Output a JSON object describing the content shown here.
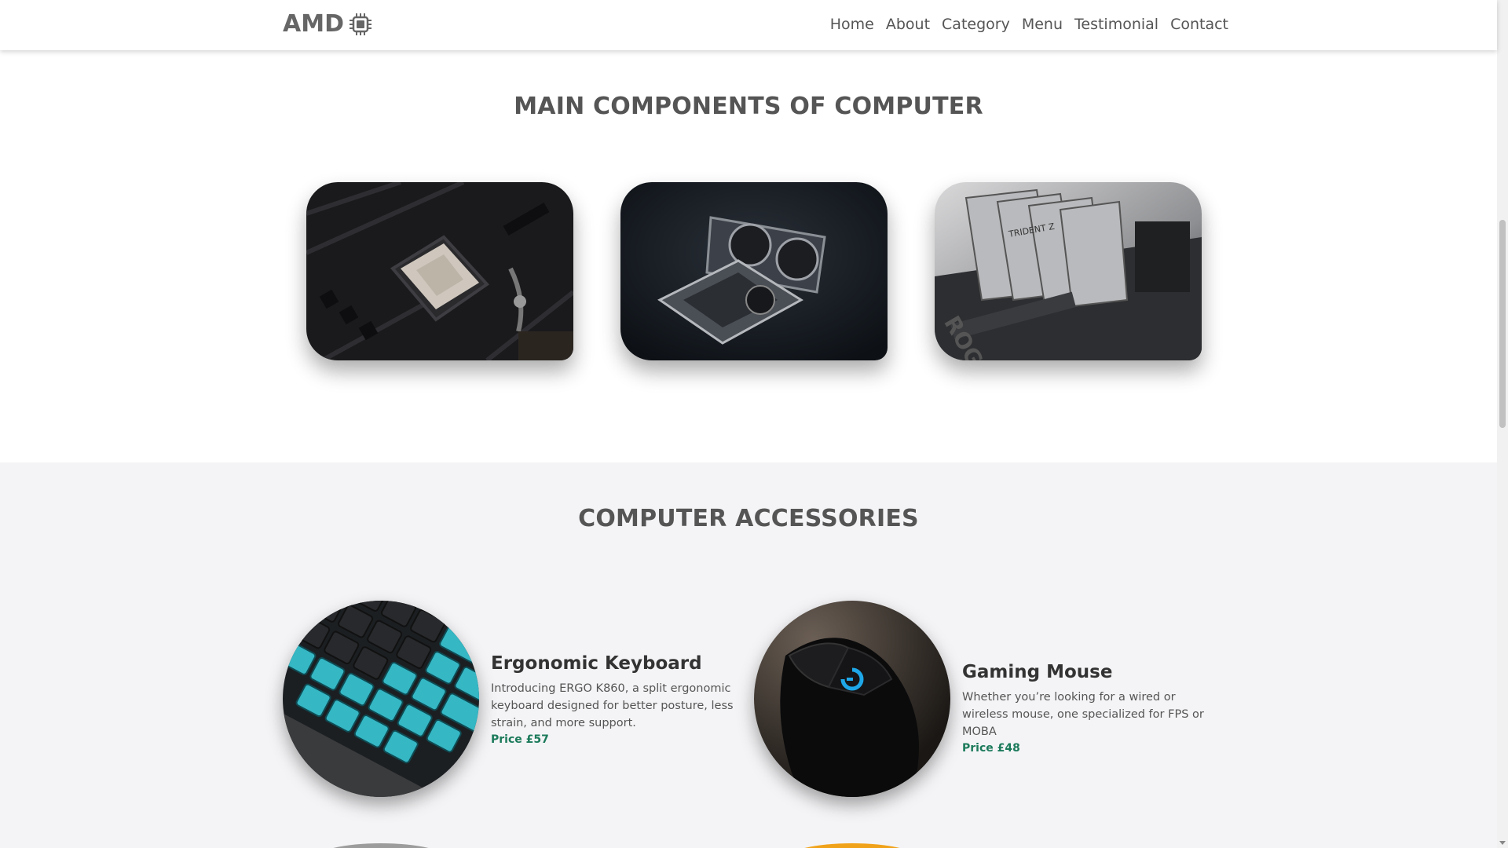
{
  "brand": {
    "name": "AMD",
    "icon": "chip-icon"
  },
  "nav": {
    "items": [
      "Home",
      "About",
      "Category",
      "Menu",
      "Testimonial",
      "Contact"
    ]
  },
  "components": {
    "title": "MAIN COMPONENTS OF COMPUTER",
    "cards": [
      {
        "image": "cpu-motherboard-image"
      },
      {
        "image": "graphics-cards-image"
      },
      {
        "image": "ram-modules-image"
      }
    ]
  },
  "accessories": {
    "title": "COMPUTER ACCESSORIES",
    "items": [
      {
        "image": "keyboard-image",
        "title": "Ergonomic Keyboard",
        "desc": "Introducing ERGO K860, a split ergonomic keyboard designed for better posture, less strain, and more support.",
        "price": "Price £57"
      },
      {
        "image": "mouse-image",
        "title": "Gaming Mouse",
        "desc": "Whether you’re looking for a wired or wireless mouse, one specialized for FPS or MOBA",
        "price": "Price £48"
      }
    ]
  },
  "colors": {
    "price": "#1b7a5a",
    "section_alt_bg": "#f4f4f6",
    "accent_mouse": "#1ea7e8"
  }
}
